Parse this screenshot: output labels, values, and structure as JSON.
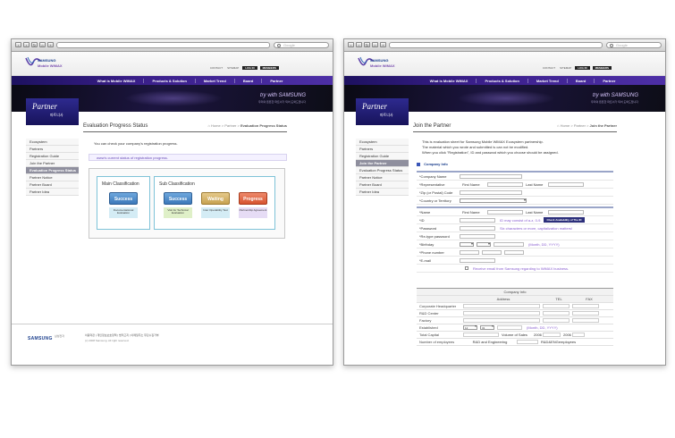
{
  "left_window": {
    "browser": {
      "search_placeholder": "Google"
    },
    "header": {
      "logo_text": "SAMSUNG",
      "logo_sub": "Mobile WiMAX",
      "util_links": [
        "CONTACT",
        "SITEMAP"
      ],
      "login_label": "LOG IN",
      "member_label": "MEMBERS"
    },
    "gnb": [
      "What is Mobile WiMAX",
      "Products & Solution",
      "Market Trend",
      "Board",
      "Partner"
    ],
    "visual": {
      "tagline": "try with SAMSUNG",
      "sub": "우리의 튼튼한 파트너가 되어 도와드립니다"
    },
    "section": {
      "title": "Partner",
      "title_kr": "파트너사"
    },
    "lnb": [
      {
        "label": "Ecosystem",
        "active": false
      },
      {
        "label": "Partners",
        "active": false
      },
      {
        "label": "Registration Guide",
        "active": false
      },
      {
        "label": "Join the Partner",
        "active": false
      },
      {
        "label": "Evaluation Progress Status",
        "active": true
      },
      {
        "label": "Partner Notice",
        "active": false
      },
      {
        "label": "Partner Board",
        "active": false
      },
      {
        "label": "Partner Idea",
        "active": false
      }
    ],
    "page_title": "Evaluation Progress Status",
    "breadcrumb": {
      "home": "Home",
      "sep": ">",
      "parent": "Partner",
      "current": "Evaluation Progress Status"
    },
    "message": "You can check your company's registration progress.",
    "notice": "www's current status of registration progress.",
    "main_classification": {
      "title": "Main Classification",
      "stage": {
        "status": "Success",
        "desc": "Documentational Evaluation"
      }
    },
    "sub_classification": {
      "title": "Sub Classification",
      "stages": [
        {
          "status": "Success",
          "desc": "Visit for Technical Evaluation"
        },
        {
          "status": "Waiting",
          "desc": "Inter Operability Test"
        },
        {
          "status": "Progress",
          "desc": "Partnership Agreement"
        }
      ]
    },
    "footer": {
      "brand": "SAMSUNG",
      "brand_sub": "삼성전자",
      "links": "이용약관 | 개인정보보호정책 | 법적고지 | 이메일주소 무단수집거부",
      "copyright": "(c) 2008 Samsung. All right reserved."
    }
  },
  "right_window": {
    "browser": {
      "search_placeholder": "Google"
    },
    "header": {
      "logo_text": "SAMSUNG",
      "logo_sub": "Mobile WiMAX",
      "util_links": [
        "CONTACT",
        "SITEMAP"
      ],
      "login_label": "LOG IN",
      "member_label": "MEMBERS"
    },
    "gnb": [
      "What is Mobile WiMAX",
      "Products & Solution",
      "Market Trend",
      "Board",
      "Partner"
    ],
    "visual": {
      "tagline": "try with SAMSUNG",
      "sub": "우리의 튼튼한 파트너가 되어 도와드립니다"
    },
    "section": {
      "title": "Partner",
      "title_kr": "파트너사"
    },
    "lnb": [
      {
        "label": "Ecosystem",
        "active": false
      },
      {
        "label": "Partners",
        "active": false
      },
      {
        "label": "Registration Guide",
        "active": false
      },
      {
        "label": "Join the Partner",
        "active": true
      },
      {
        "label": "Evaluation Progress Status",
        "active": false
      },
      {
        "label": "Partner Notice",
        "active": false
      },
      {
        "label": "Partner Board",
        "active": false
      },
      {
        "label": "Partner Idea",
        "active": false
      }
    ],
    "page_title": "Join the Partner",
    "breadcrumb": {
      "home": "Home",
      "sep": ">",
      "parent": "Partner",
      "current": "Join the Partner"
    },
    "intro": [
      "This is evaluation sheet for Samsung Mobile WiMAX Ecosystem partnership.",
      "The material which you wrote and submitted is can not be modified.",
      "When you click \"Registration\", ID and passwod which you choose should be assigned."
    ],
    "company_info_title": "Company Info",
    "company_rows": {
      "company_name": "*Company Name",
      "representative": "*Representative",
      "first_name": "First Name",
      "last_name": "Last Name",
      "zip": "*Zip (or Postal) Code",
      "country": "*Country or Territory"
    },
    "account_rows": {
      "name": "*Name",
      "first_name": "First Name",
      "last_name": "Last Name",
      "id": "*ID",
      "id_hint": "ID may consist of a-z, 0-9.",
      "check_btn": "Check Availability of The ID",
      "password": "*Password",
      "password_hint": "Six characters or more, capitalization matters!",
      "password_re": "*Re-type password",
      "birthday": "*Birthday",
      "birthday_hint": "(Month, DD, YYYY)",
      "phone": "*Phone number",
      "email": "*E-mail",
      "email_optin": "Receive email from Samsung regarding to WiMAX business."
    },
    "company_table": {
      "caption": "Company Info",
      "headers": [
        "Address",
        "TEL",
        "FAX"
      ],
      "rows": [
        "Corporate Headquarter",
        "R&D Center",
        "Factory"
      ],
      "established_label": "Established",
      "established_month": "12",
      "established_day": "31",
      "established_hint": "(Month, DD, YYYY)",
      "total_capital": "Total Capital",
      "volume_of_sales": "Volume of Sales",
      "year1": "2006",
      "year2": "2006",
      "employees": "Number of employees",
      "rnd_eng": "R&D and Engineering",
      "rnd_eng_emp": "R&D&ENGemployees"
    }
  }
}
